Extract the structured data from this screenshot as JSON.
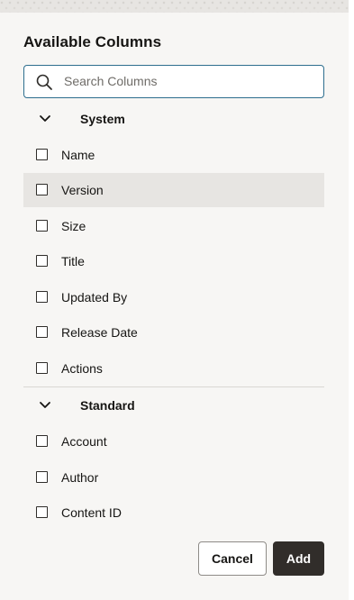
{
  "dialog": {
    "title": "Available Columns"
  },
  "search": {
    "placeholder": "Search Columns",
    "value": ""
  },
  "groups": [
    {
      "label": "System",
      "expanded": true,
      "items": [
        {
          "label": "Name",
          "checked": false
        },
        {
          "label": "Version",
          "checked": false,
          "hovered": true
        },
        {
          "label": "Size",
          "checked": false
        },
        {
          "label": "Title",
          "checked": false
        },
        {
          "label": "Updated By",
          "checked": false
        },
        {
          "label": "Release Date",
          "checked": false
        },
        {
          "label": "Actions",
          "checked": false
        }
      ]
    },
    {
      "label": "Standard",
      "expanded": true,
      "items": [
        {
          "label": "Account",
          "checked": false
        },
        {
          "label": "Author",
          "checked": false
        },
        {
          "label": "Content ID",
          "checked": false
        }
      ]
    }
  ],
  "buttons": {
    "cancel_label": "Cancel",
    "add_label": "Add"
  },
  "colors": {
    "focus_border": "#2d6e8e",
    "primary_button": "#312d2a",
    "panel_background": "#f7f6f4",
    "row_hover": "#e7e5e2"
  },
  "icons": {
    "search": "search-icon",
    "group_toggle": "chevron-down-icon",
    "checkbox": "checkbox-unchecked"
  }
}
